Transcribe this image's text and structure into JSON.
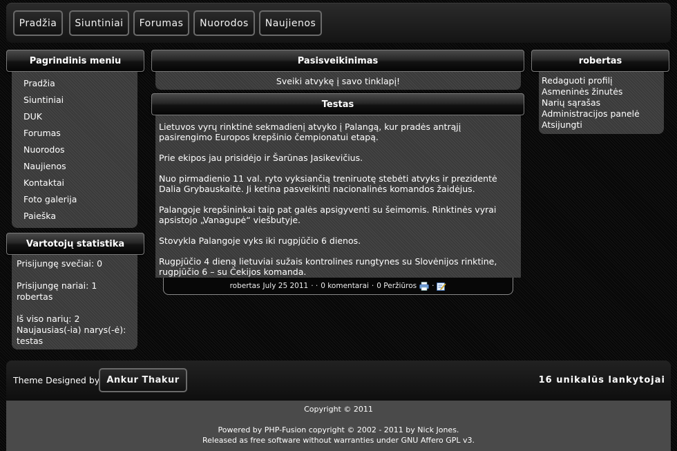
{
  "nav": {
    "items": [
      {
        "label": "Pradžia"
      },
      {
        "label": "Siuntiniai"
      },
      {
        "label": "Forumas"
      },
      {
        "label": "Nuorodos"
      },
      {
        "label": "Naujienos"
      }
    ]
  },
  "left_menu": {
    "title": "Pagrindinis meniu",
    "items": [
      "Pradžia",
      "Siuntiniai",
      "DUK",
      "Forumas",
      "Nuorodos",
      "Naujienos",
      "Kontaktai",
      "Foto galerija",
      "Paieška"
    ]
  },
  "stats": {
    "title": "Vartotojų statistika",
    "guests": "Prisijungę svečiai: 0",
    "members": "Prisijungę nariai: 1",
    "member_name": "robertas",
    "total": "Iš viso narių: 2",
    "newest_label": "Naujausias(-ia) narys(-ė):",
    "newest_name": "testas"
  },
  "welcome": {
    "title": "Pasisveikinimas",
    "text": "Sveiki atvykę į savo tinklapį!"
  },
  "news": {
    "title": "Testas",
    "paragraphs": [
      "Lietuvos vyrų rinktinė sekmadienį atvyko į Palangą, kur pradės antrąjį pasirengimo Europos krepšinio čempionatui etapą.",
      "Prie ekipos jau prisidėjo ir Šarūnas Jasikevičius.",
      "Nuo pirmadienio 11 val. ryto vyksiančią treniruotę stebėti atvyks ir prezidentė Dalia Grybauskaitė. Ji ketina pasveikinti nacionalinės komandos žaidėjus.",
      "Palangoje krepšininkai taip pat galės apsigyventi su šeimomis. Rinktinės vyrai apsistojo „Vanagupė“ viešbutyje.",
      "Stovykla Palangoje vyks iki rugpjūčio 6 dienos.",
      "Rugpjūčio 4 dieną lietuviai sužais kontrolines rungtynes su Slovėnijos rinktine, rugpjūčio 6 – su Čekijos komanda."
    ],
    "footer": {
      "author": "robertas",
      "date": "July 25 2011",
      "sep1": "· ·",
      "comments": "0 komentarai",
      "sep2": "·",
      "reads": "0 Peržiūros",
      "sep3": "·",
      "print_icon": "printer-icon",
      "edit_icon": "edit-icon"
    }
  },
  "user_panel": {
    "title": "robertas",
    "items": [
      "Redaguoti profilį",
      "Asmeninės žinutės",
      "Narių sąrašas",
      "Administracijos panelė",
      "Atsijungti"
    ]
  },
  "footer": {
    "designed_by": "Theme Designed by",
    "designer": "Ankur Thakur",
    "visitors": "16 unikalūs lankytojai",
    "copyright": "Copyright © 2011",
    "powered": "Powered by PHP-Fusion copyright © 2002 - 2011 by Nick Jones.",
    "license": "Released as free software without warranties under GNU Affero GPL v3."
  }
}
